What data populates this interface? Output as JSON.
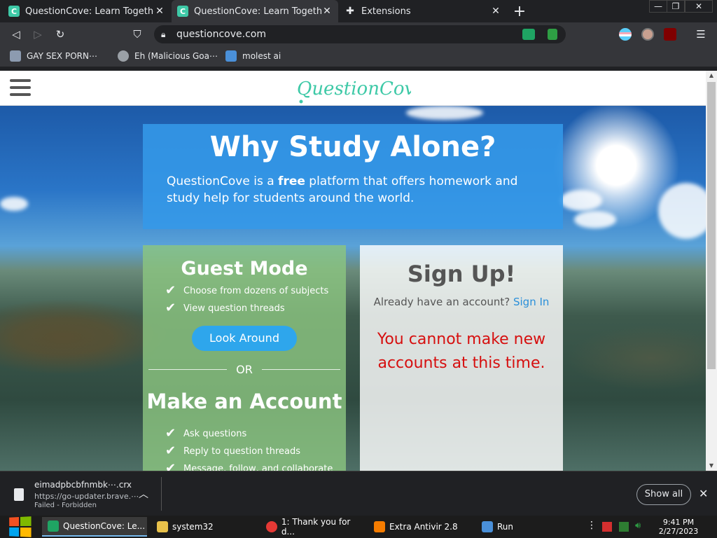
{
  "tabs": [
    {
      "label": "QuestionCove: Learn Together",
      "favicon": "questioncove-favicon",
      "active": false
    },
    {
      "label": "QuestionCove: Learn Together",
      "favicon": "questioncove-favicon",
      "active": true
    },
    {
      "label": "Extensions",
      "favicon": "puzzle-icon",
      "active": false
    }
  ],
  "toolbar": {
    "url": "questioncove.com"
  },
  "bookmarks": [
    {
      "label": "GAY SEX PORN⋯"
    },
    {
      "label": "Eh (Malicious Goa⋯"
    },
    {
      "label": "molest ai"
    }
  ],
  "site": {
    "logo_text": "QuestionCove",
    "hero_title": "Why Study Alone?",
    "hero_text_pre": "QuestionCove is a ",
    "hero_text_bold": "free",
    "hero_text_post": " platform that offers homework and study help for students around the world.",
    "guest": {
      "title": "Guest Mode",
      "features": [
        "Choose from dozens of subjects",
        "View question threads"
      ],
      "button": "Look Around",
      "or": "OR",
      "account_title": "Make an Account",
      "account_features": [
        "Ask questions",
        "Reply to question threads",
        "Message, follow, and collaborate"
      ]
    },
    "signup": {
      "title": "Sign Up!",
      "have_account": "Already have an account?",
      "sign_in": "Sign In",
      "warning": "You cannot make new accounts at this time."
    }
  },
  "download": {
    "filename": "eimadpbcbfnmbk⋯.crx",
    "url": "https://go-updater.brave.⋯",
    "status": "Failed - Forbidden",
    "show_all": "Show all"
  },
  "taskbar": {
    "items": [
      {
        "label": "QuestionCove: Le...",
        "active": true
      },
      {
        "label": "system32",
        "active": false
      },
      {
        "label": "1: Thank you for d...",
        "active": false
      },
      {
        "label": "Extra Antivir 2.8",
        "active": false
      },
      {
        "label": "Run",
        "active": false
      }
    ],
    "time": "9:41 PM",
    "date": "2/27/2023"
  },
  "colors": {
    "brand": "#3ec9a7",
    "hero_blue": "#3498e8",
    "guest_green": "#8bc480",
    "warning_red": "#d60f0f",
    "link_blue": "#2a8fd9"
  }
}
